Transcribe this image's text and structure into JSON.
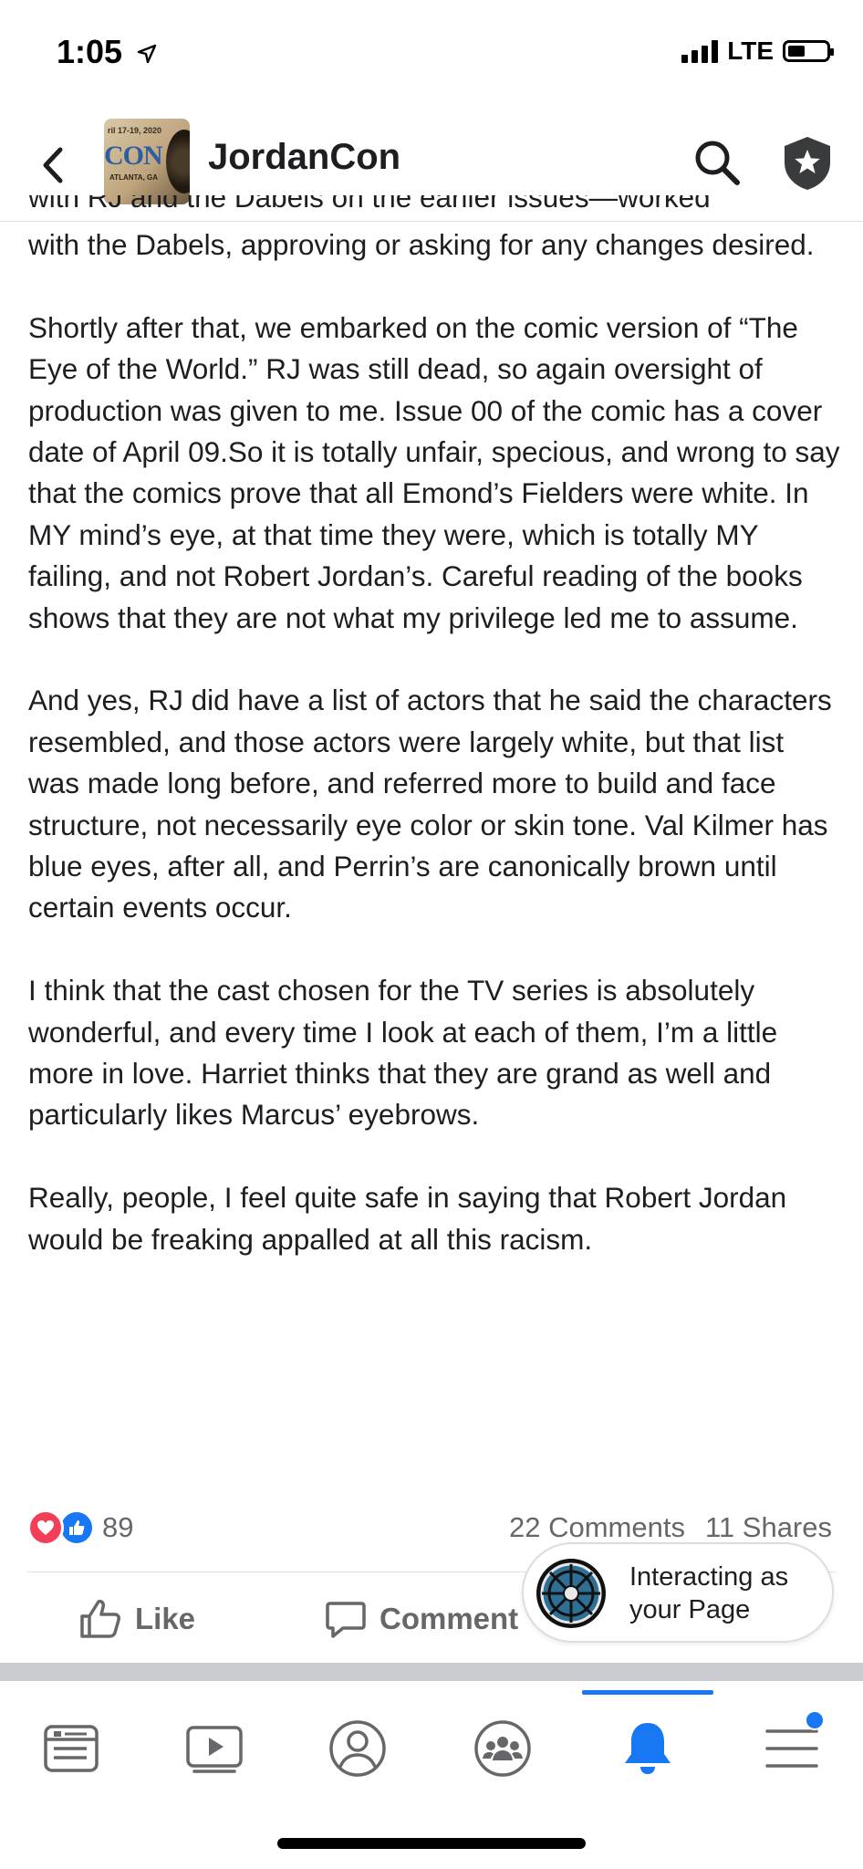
{
  "status_bar": {
    "time": "1:05",
    "network": "LTE",
    "battery_level": 0.45
  },
  "header": {
    "page_name": "JordanCon",
    "avatar": {
      "date": "ril 17-19, 2020",
      "logo": "CON",
      "city": "ATLANTA, GA"
    }
  },
  "post": {
    "partial_line": "with RJ and the Dabels on the earlier issues—worked",
    "paragraphs": [
      "with the Dabels, approving or asking for any changes desired.",
      "Shortly after that, we embarked on the comic version of “The Eye of the World.” RJ was still dead, so again oversight of production was given to me. Issue 00 of the comic has a cover date of April 09.So it is totally unfair, specious, and wrong to say that the comics prove that all Emond’s Fielders were white. In MY mind’s eye, at that time they were, which is totally MY failing, and not Robert Jordan’s. Careful reading of the books shows that they are not what my privilege led me to assume.",
      "And yes, RJ did have a list of actors that he said the characters resembled, and those actors were largely white, but that list was made long before, and referred more to build and face structure, not necessarily eye color or skin tone. Val Kilmer has blue eyes, after all, and Perrin’s are canonically brown until certain events occur.",
      "I think that the cast chosen for the TV series is absolutely wonderful, and every time I look at each of them, I’m a little more in love. Harriet thinks that they are grand as well and particularly likes Marcus’ eyebrows.",
      "Really, people, I feel quite safe in saying that Robert Jordan would be freaking appalled at all this racism."
    ]
  },
  "engagement": {
    "reaction_count": "89",
    "comments": "22 Comments",
    "shares": "11 Shares"
  },
  "actions": {
    "like_label": "Like",
    "comment_label": "Comment"
  },
  "interacting_chip": {
    "line1": "Interacting as",
    "line2": "your Page"
  },
  "bottom_nav": {
    "items": [
      "news-feed",
      "watch",
      "profile",
      "groups",
      "notifications",
      "menu"
    ],
    "active": "notifications"
  },
  "colors": {
    "accent": "#1877f2",
    "love": "#f33e58",
    "text": "#1c1e21",
    "secondary_text": "#65676b"
  }
}
